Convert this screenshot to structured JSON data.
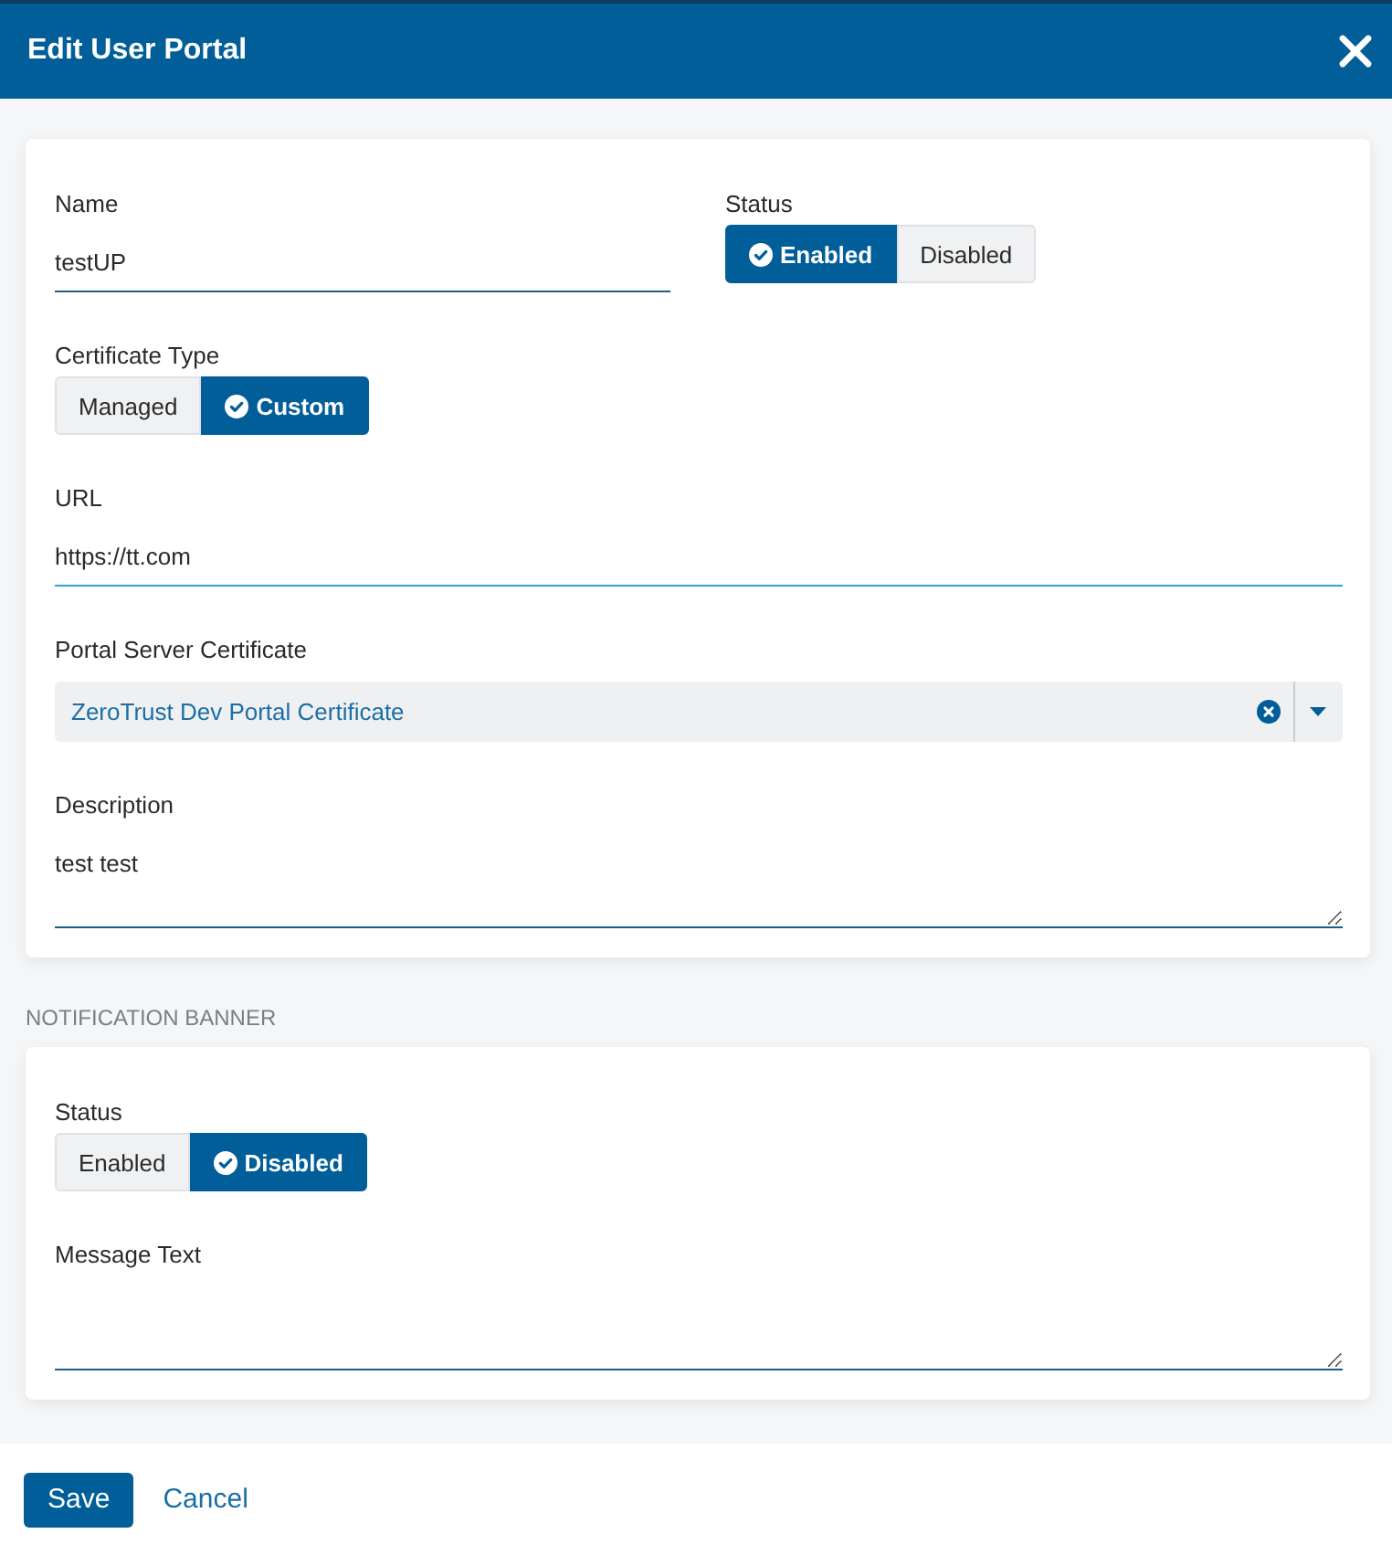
{
  "dialog": {
    "title": "Edit User Portal"
  },
  "portal": {
    "name": {
      "label": "Name",
      "value": "testUP"
    },
    "status": {
      "label": "Status",
      "options": [
        {
          "label": "Enabled",
          "selected": true
        },
        {
          "label": "Disabled",
          "selected": false
        }
      ]
    },
    "certificate_type": {
      "label": "Certificate Type",
      "options": [
        {
          "label": "Managed",
          "selected": false
        },
        {
          "label": "Custom",
          "selected": true
        }
      ]
    },
    "url": {
      "label": "URL",
      "value": "https://tt.com",
      "focused": true
    },
    "portal_server_certificate": {
      "label": "Portal Server Certificate",
      "value": "ZeroTrust Dev Portal Certificate"
    },
    "description": {
      "label": "Description",
      "value": "test test"
    }
  },
  "notification_banner": {
    "heading": "NOTIFICATION BANNER",
    "status": {
      "label": "Status",
      "options": [
        {
          "label": "Enabled",
          "selected": false
        },
        {
          "label": "Disabled",
          "selected": true
        }
      ]
    },
    "message_text": {
      "label": "Message Text"
    }
  },
  "footer": {
    "buttons": [
      {
        "label": "Save",
        "kind": "primary"
      },
      {
        "label": "Cancel",
        "kind": "link"
      }
    ]
  }
}
